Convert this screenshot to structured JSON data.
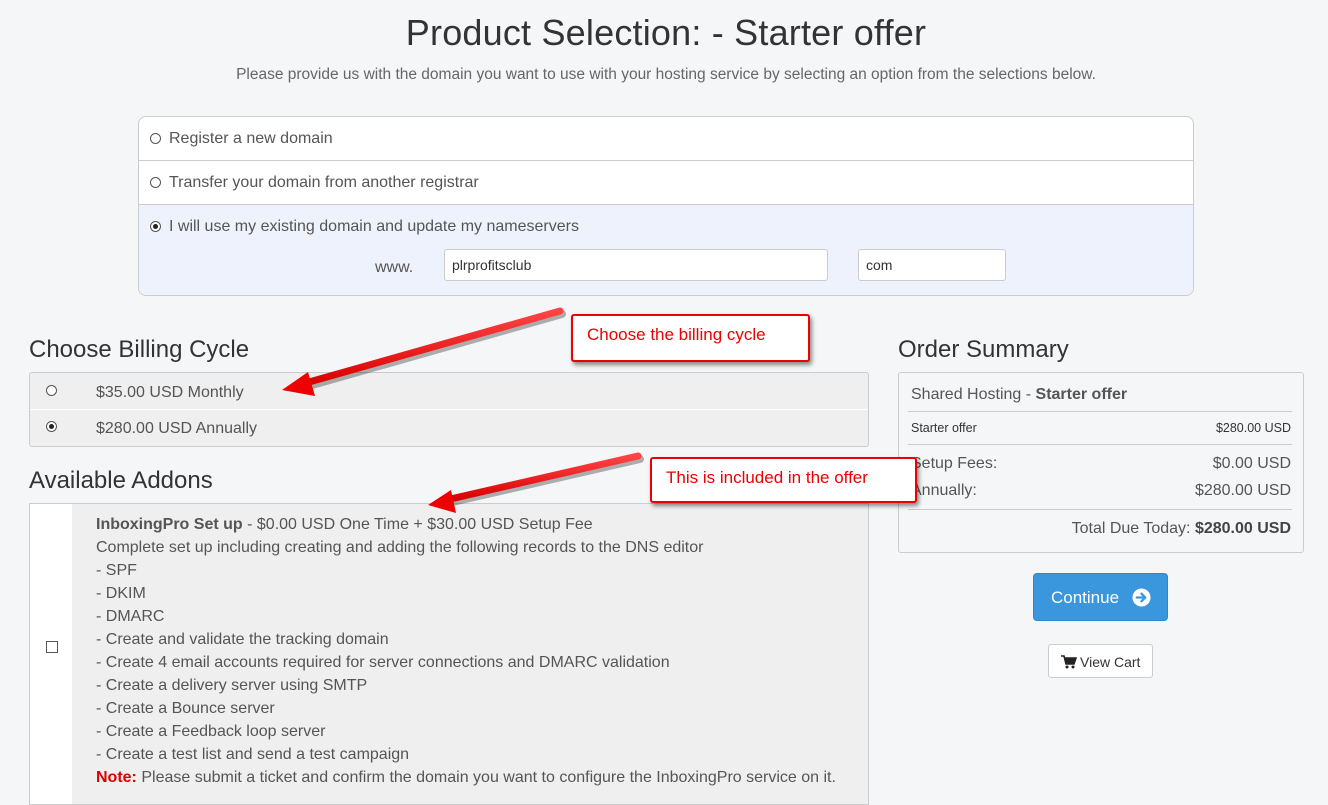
{
  "header": {
    "title": "Product Selection: - Starter offer",
    "subtitle": "Please provide us with the domain you want to use with your hosting service by selecting an option from the selections below."
  },
  "domain": {
    "options": [
      {
        "label": "Register a new domain",
        "selected": false
      },
      {
        "label": "Transfer your domain from another registrar",
        "selected": false
      },
      {
        "label": "I will use my existing domain and update my nameservers",
        "selected": true
      }
    ],
    "prefix": "www.",
    "sld_value": "plrprofitsclub",
    "tld_value": "com"
  },
  "billing": {
    "title": "Choose Billing Cycle",
    "options": [
      {
        "label": "$35.00 USD Monthly",
        "selected": false
      },
      {
        "label": "$280.00 USD Annually",
        "selected": true
      }
    ]
  },
  "addons": {
    "title": "Available Addons",
    "item": {
      "name": "InboxingPro Set up",
      "price": " - $0.00 USD One Time + $30.00 USD Setup Fee",
      "lines": [
        "Complete set up including creating and adding the following records to the DNS editor",
        "- SPF",
        "- DKIM",
        "- DMARC",
        "- Create and validate the tracking domain",
        "- Create 4 email accounts required for server connections and DMARC validation",
        "- Create a delivery server using SMTP",
        "- Create a Bounce server",
        "- Create a Feedback loop server",
        "- Create a test list and send a test campaign"
      ],
      "note_label": "Note:",
      "note_text": " Please submit a ticket and confirm the domain you want to configure the InboxingPro service on it.",
      "checked": false
    }
  },
  "summary": {
    "title": "Order Summary",
    "product_group": "Shared Hosting - ",
    "product_name": "Starter offer",
    "line_item": {
      "label": "Starter offer",
      "value": "$280.00 USD"
    },
    "setup_fees": {
      "label": "Setup Fees:",
      "value": "$0.00 USD"
    },
    "annually": {
      "label": "Annually:",
      "value": "$280.00 USD"
    },
    "total_label": "Total Due Today: ",
    "total_value": "$280.00 USD"
  },
  "actions": {
    "continue_label": "Continue",
    "view_cart_label": "View Cart"
  },
  "callouts": {
    "billing": "Choose the billing cycle",
    "included": "This is included in the offer"
  },
  "colors": {
    "primary": "#3a96dd",
    "callout_red": "#e00000",
    "selected_row_bg": "#eef2fc"
  }
}
